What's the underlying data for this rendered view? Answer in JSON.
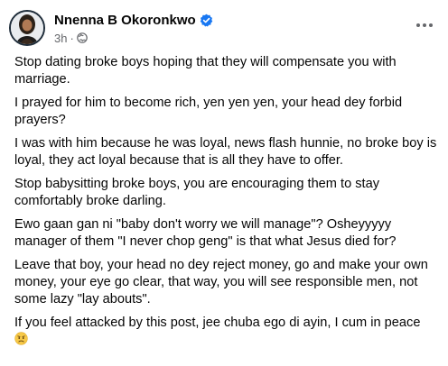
{
  "post": {
    "author_name": "Nnenna B Okoronkwo",
    "timestamp": "3h",
    "separator": "·",
    "icons": {
      "verified": "verified-badge-icon",
      "audience": "globe-icon",
      "menu": "more-options-icon",
      "emoji": "worried-face-emoji"
    },
    "colors": {
      "verified": "#1877f2",
      "meta_text": "#65676b",
      "text": "#050505"
    },
    "paragraphs": [
      "Stop dating broke boys hoping that they will compensate you with marriage.",
      "I prayed for him to become rich, yen yen yen, your head dey forbid prayers?",
      "I was with him because he was loyal, news flash hunnie,  no broke boy is loyal, they act loyal because that is all they have to offer.",
      "Stop babysitting broke boys, you are encouraging them to stay comfortably broke darling.",
      "Ewo gaan gan ni \"baby don't worry we will manage\"? Osheyyyyy manager of them \"I never chop geng\" is that what Jesus died for?",
      "Leave that boy, your head no dey reject money, go and make your own money,  your eye go clear, that way,  you will see responsible men, not some lazy \"lay abouts\".",
      "If you feel attacked by this post, jee chuba ego di ayin,  I cum in peace"
    ]
  }
}
